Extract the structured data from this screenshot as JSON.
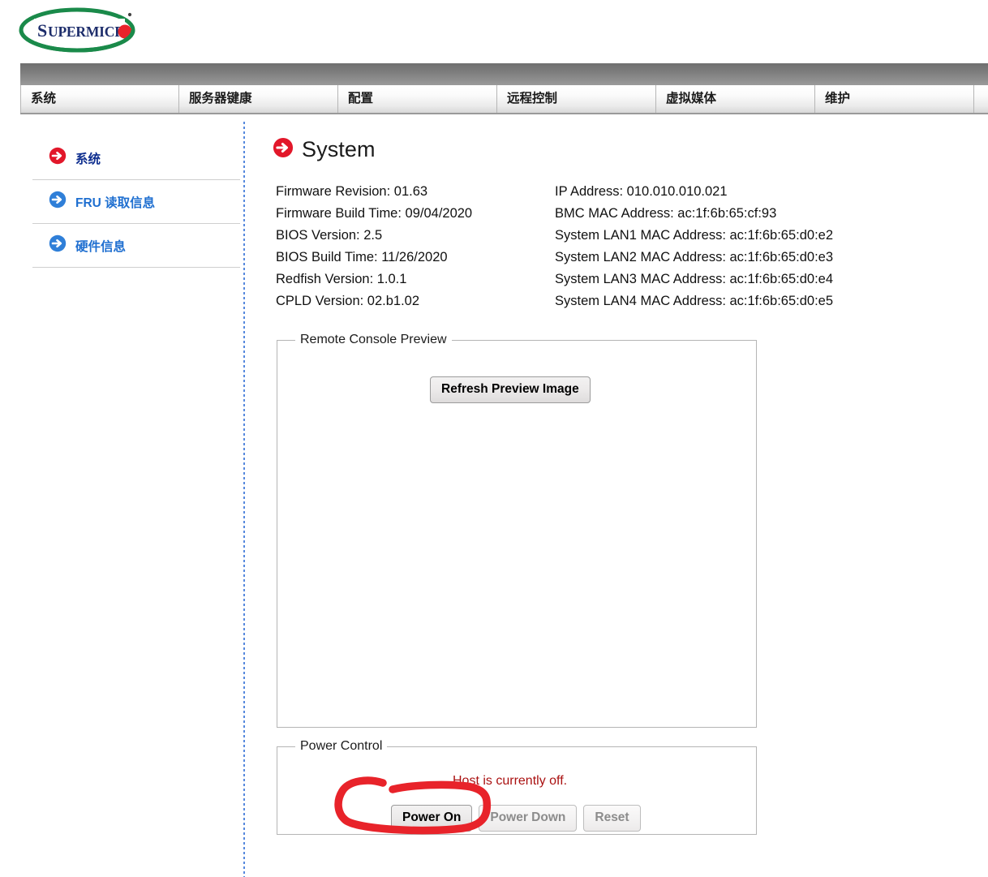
{
  "brand": {
    "logo_text": "SUPERMICRO",
    "logo_colors": {
      "ring": "#1a8a4a",
      "text": "#1d2d6b",
      "dot": "#e8232a"
    }
  },
  "nav": {
    "tabs": [
      {
        "label": "系统",
        "name": "tab-system"
      },
      {
        "label": "服务器键康",
        "name": "tab-server-health"
      },
      {
        "label": "配置",
        "name": "tab-configuration"
      },
      {
        "label": "远程控制",
        "name": "tab-remote-control"
      },
      {
        "label": "虚拟媒体",
        "name": "tab-virtual-media"
      },
      {
        "label": "维护",
        "name": "tab-maintenance"
      }
    ]
  },
  "sidebar": {
    "items": [
      {
        "label": "系统",
        "icon": "arrow-right-circle-red-icon",
        "active": true
      },
      {
        "label": "FRU 读取信息",
        "icon": "arrow-right-circle-blue-icon",
        "active": false
      },
      {
        "label": "硬件信息",
        "icon": "arrow-right-circle-blue-icon",
        "active": false
      }
    ]
  },
  "main": {
    "heading": "System",
    "heading_icon": "arrow-right-circle-red-icon",
    "info_left": [
      "Firmware Revision:  01.63",
      "Firmware Build Time:  09/04/2020",
      "BIOS Version: 2.5",
      "BIOS Build Time: 11/26/2020",
      "Redfish Version: 1.0.1",
      "CPLD Version: 02.b1.02"
    ],
    "info_right": [
      "IP Address:  010.010.010.021",
      "BMC MAC Address:  ac:1f:6b:65:cf:93",
      "System LAN1 MAC Address: ac:1f:6b:65:d0:e2",
      "System LAN2 MAC Address: ac:1f:6b:65:d0:e3",
      "System LAN3 MAC Address: ac:1f:6b:65:d0:e4",
      "System LAN4 MAC Address: ac:1f:6b:65:d0:e5"
    ],
    "preview": {
      "legend": "Remote Console Preview",
      "refresh_label": "Refresh Preview Image"
    },
    "power": {
      "legend": "Power Control",
      "status": "Host is currently off.",
      "status_color": "#aa1111",
      "buttons": [
        {
          "label": "Power On",
          "disabled": false
        },
        {
          "label": "Power Down",
          "disabled": true
        },
        {
          "label": "Reset",
          "disabled": true
        }
      ]
    }
  },
  "annotation": {
    "shape": "hand-drawn-red-circle",
    "target": "Power On",
    "color": "#e8232a"
  }
}
